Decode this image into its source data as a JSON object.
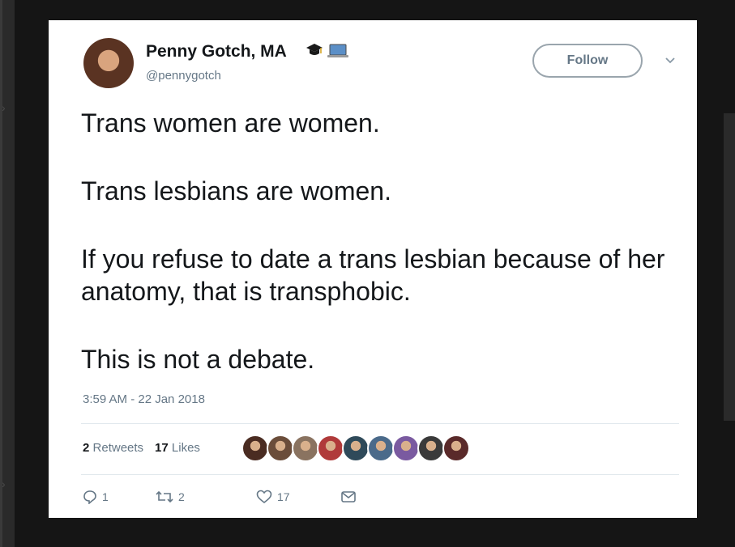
{
  "colors": {
    "accent": "#657786",
    "text": "#14171a",
    "background": "#151515",
    "card": "#ffffff"
  },
  "user": {
    "display_name": "Penny Gotch, MA",
    "handle": "@pennygotch",
    "badges": [
      "graduation-cap-icon",
      "laptop-icon"
    ]
  },
  "follow_label": "Follow",
  "tweet": {
    "paragraphs": [
      "Trans women are women.",
      "Trans lesbians are women.",
      "If you refuse to date a trans lesbian because of her anatomy, that is transphobic.",
      "This is not a debate."
    ],
    "timestamp": "3:59 AM - 22 Jan 2018"
  },
  "stats": {
    "retweets_count": "2",
    "retweets_label": "Retweets",
    "likes_count": "17",
    "likes_label": "Likes"
  },
  "likers": [
    "#4a2c22",
    "#6b4d3a",
    "#8a7360",
    "#b03a3a",
    "#2f4a5a",
    "#4a6a8a",
    "#7a5aa0",
    "#3a3a3a",
    "#5a2a2a"
  ],
  "actions": {
    "reply_count": "1",
    "retweet_count": "2",
    "like_count": "17"
  }
}
